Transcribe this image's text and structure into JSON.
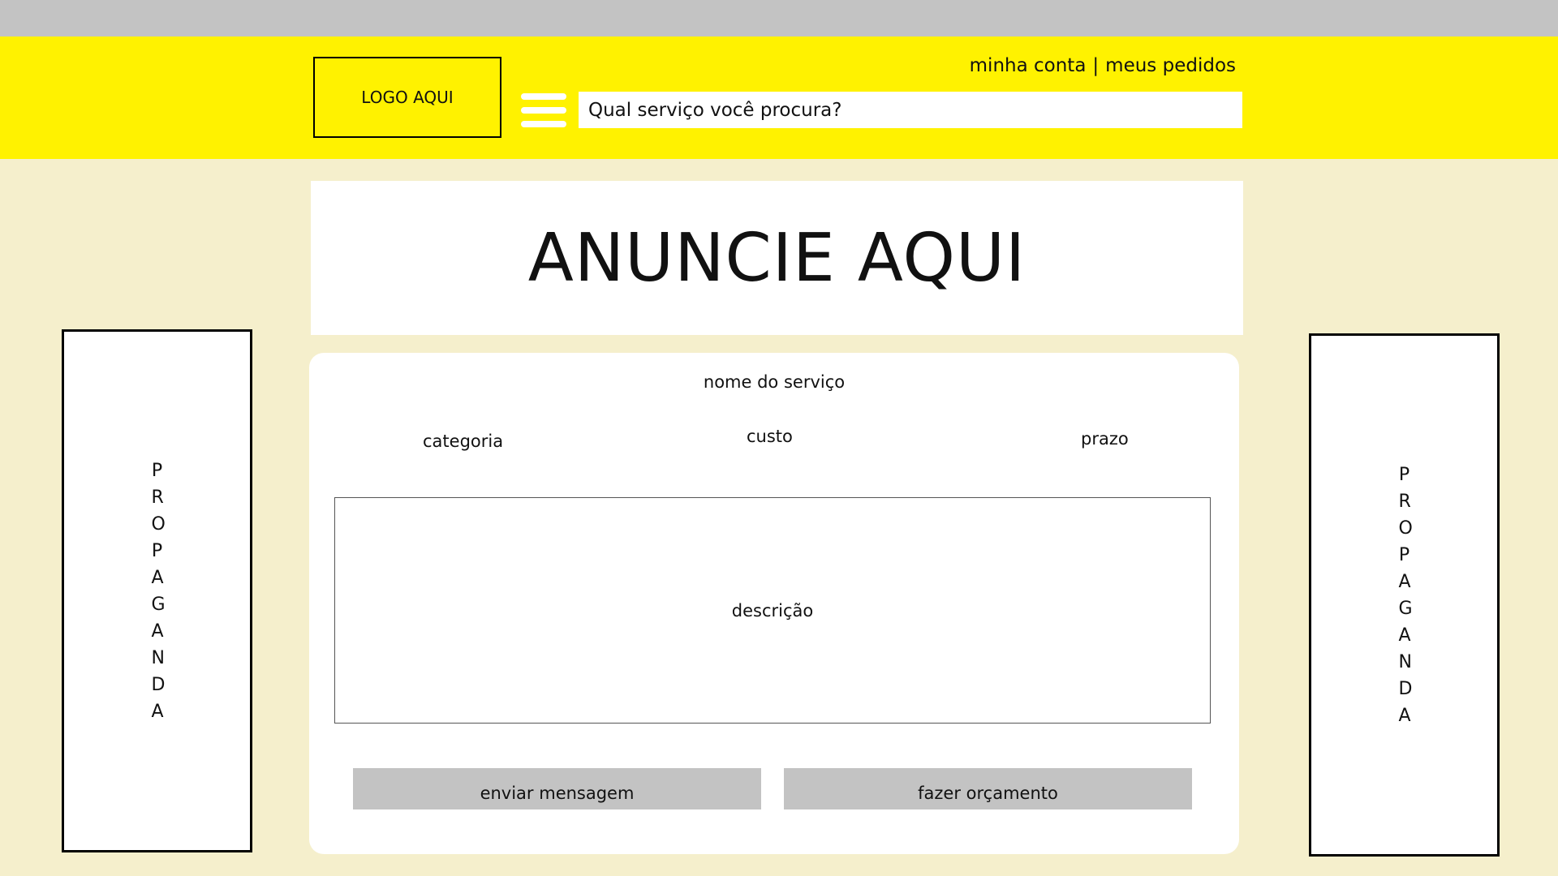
{
  "header": {
    "logo_text": "LOGO AQUI",
    "account_link": "minha conta",
    "separator": "|",
    "orders_link": "meus pedidos",
    "search_placeholder": "Qual serviço você procura?"
  },
  "banner": {
    "text": "ANUNCIE AQUI"
  },
  "side_ads": {
    "left_text": "PROPAGANDA",
    "right_text": "PROPAGANDA"
  },
  "service": {
    "name_label": "nome do serviço",
    "category_label": "categoria",
    "cost_label": "custo",
    "term_label": "prazo",
    "description_label": "descrição",
    "send_message_label": "enviar mensagem",
    "quote_label": "fazer orçamento"
  },
  "colors": {
    "top_bar": "#c3c3c3",
    "header": "#fff200",
    "page_background": "#f5efcc",
    "button": "#c3c3c3"
  },
  "icons": {
    "menu": "hamburger-menu-icon"
  }
}
